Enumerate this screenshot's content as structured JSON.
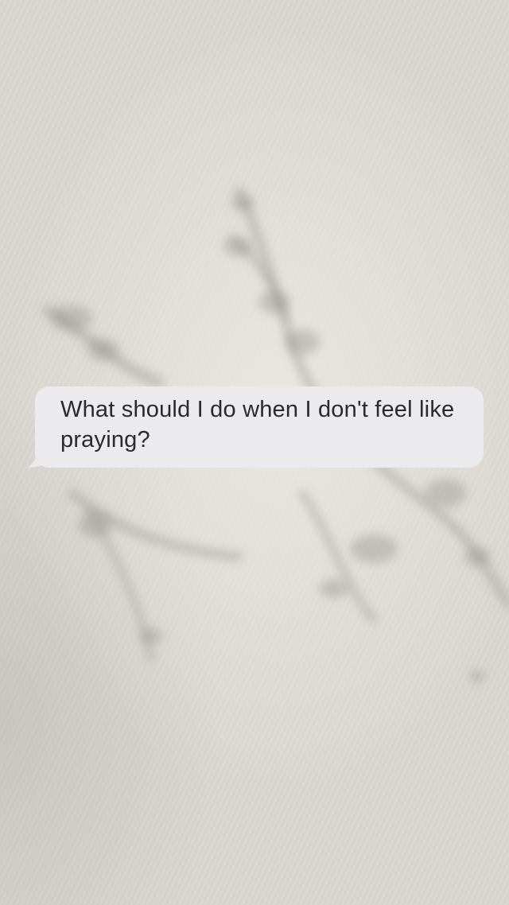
{
  "message": {
    "text": "What should I do when I don't feel like praying?",
    "bubble_color": "#ebeaec",
    "text_color": "#2a2a2a"
  },
  "background": {
    "description_color": "#d9d5d1",
    "shadow_color": "#8e918a"
  }
}
